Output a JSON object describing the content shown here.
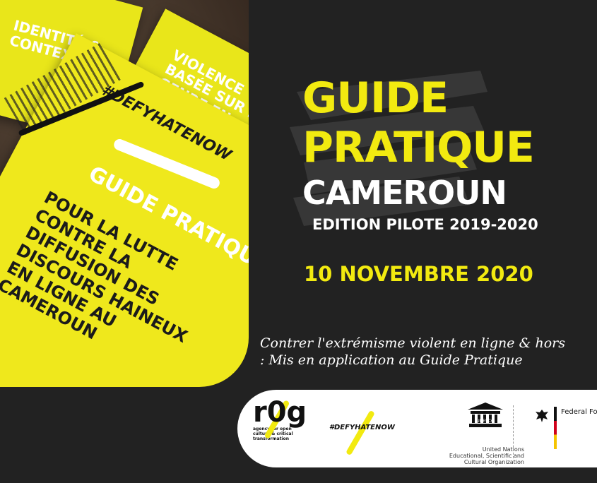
{
  "photo": {
    "booklet_left_text": "IDENTITÉ & CONTEXTE",
    "booklet_top_text": "VIOLENCE BASÉE SUR LE GENRE EN",
    "booklet_main_hashtag": "#DEFYHATENOW",
    "booklet_main_title": "GUIDE PRATIQUE",
    "booklet_main_body": "POUR LA LUTTE CONTRE LA DIFFUSION DES DISCOURS HAINEUX EN LIGNE AU CAMEROUN"
  },
  "headline": {
    "line1": "GUIDE",
    "line2": "PRATIQUE",
    "line3": "CAMEROUN",
    "edition": "EDITION PILOTE 2019-2020",
    "date": "10 NOVEMBRE 2020"
  },
  "quote": {
    "line1": "Contrer l'extrémisme violent en ligne & hors",
    "line2": ": Mis en application au Guide Pratique"
  },
  "partners": {
    "r0g_mark": "r0g",
    "r0g_caption": "agency for open culture & critical transformation",
    "defyhatenow": "#DEFYHATENOW",
    "unesco_word": "UNESCO",
    "unesco_caption": "United Nations Educational, Scientific and Cultural Organization",
    "german_text": "Federal For"
  },
  "colors": {
    "background": "#222222",
    "accent_yellow": "#f2ea10",
    "white": "#ffffff"
  }
}
